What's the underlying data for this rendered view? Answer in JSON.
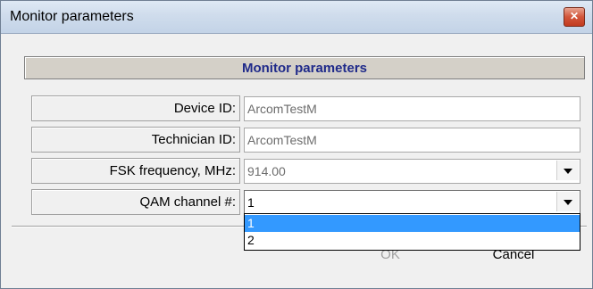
{
  "window": {
    "title": "Monitor parameters"
  },
  "header": {
    "title": "Monitor parameters"
  },
  "fields": {
    "device_id": {
      "label": "Device ID:",
      "value": "ArcomTestM"
    },
    "technician_id": {
      "label": "Technician ID:",
      "value": "ArcomTestM"
    },
    "fsk_frequency": {
      "label": "FSK frequency, MHz:",
      "value": "914.00"
    },
    "qam_channel": {
      "label": "QAM channel #:",
      "value": "1"
    }
  },
  "qam_dropdown": {
    "options": [
      "1",
      "2"
    ],
    "selected_index": 0
  },
  "buttons": {
    "ok": "OK",
    "cancel": "Cancel"
  },
  "colors": {
    "header_text": "#1f2a8a",
    "selection": "#3399ff"
  }
}
